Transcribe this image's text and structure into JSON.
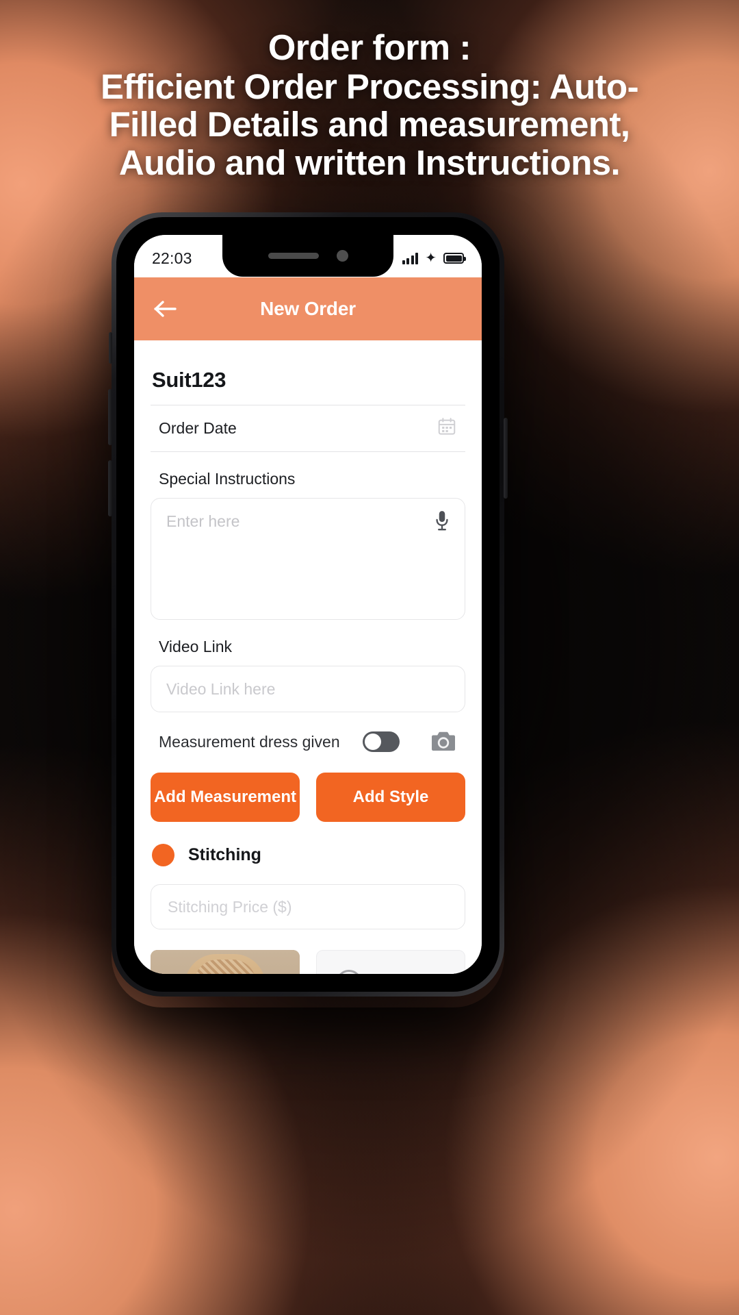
{
  "headline": {
    "line1": "Order form :",
    "line2": "Efficient Order Processing: Auto-",
    "line3": "Filled Details and measurement,",
    "line4": "Audio and written Instructions."
  },
  "theme": {
    "header_bg": "#ef8f66",
    "accent": "#f26522",
    "page_bg": "#0b0807"
  },
  "phone": {
    "status_bar": {
      "time": "22:03",
      "signal_icon": "signal-bars-icon",
      "bluetooth_icon": "sparkle-icon",
      "battery_icon": "battery-full-icon"
    },
    "app_bar": {
      "back_icon": "arrow-left-icon",
      "title": "New Order"
    },
    "form": {
      "order_title": "Suit123",
      "order_date": {
        "label": "Order Date",
        "icon": "calendar-icon"
      },
      "special_instructions": {
        "label": "Special Instructions",
        "placeholder": "Enter here",
        "value": "",
        "icon": "microphone-icon"
      },
      "video_link": {
        "label": "Video Link",
        "placeholder": "Video Link here",
        "value": ""
      },
      "measurement_dress": {
        "label": "Measurement dress given",
        "toggle_state": "off",
        "camera_icon": "camera-icon"
      },
      "buttons": {
        "add_measurement": "Add Measurement",
        "add_style": "Add Style"
      },
      "stitching": {
        "label": "Stitching",
        "selected": true,
        "price_placeholder": "Stitching Price ($)",
        "price_value": ""
      },
      "gallery": {
        "photo_alt": "suit-photo",
        "add_photo_icon": "add-image-icon"
      }
    }
  }
}
